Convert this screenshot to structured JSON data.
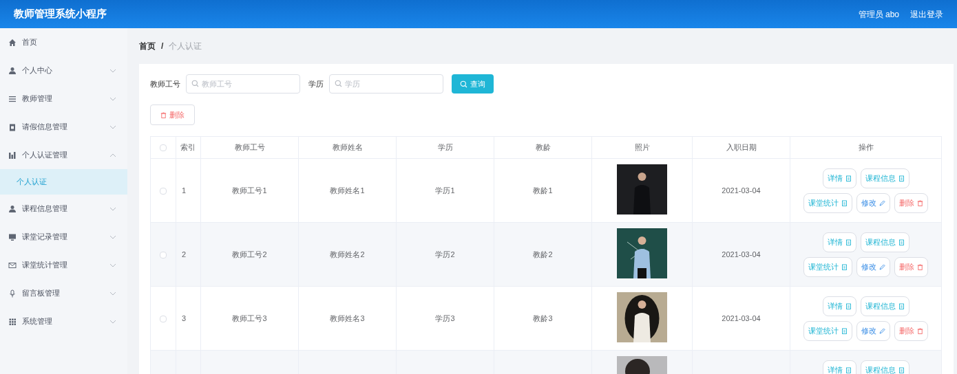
{
  "header": {
    "title": "教师管理系统小程序",
    "user": "管理员 abo",
    "logout": "退出登录"
  },
  "sidebar": {
    "items": [
      {
        "label": "首页"
      },
      {
        "label": "个人中心",
        "expanded": false
      },
      {
        "label": "教师管理",
        "expanded": false
      },
      {
        "label": "请假信息管理",
        "expanded": false
      },
      {
        "label": "个人认证管理",
        "expanded": true,
        "children": [
          {
            "label": "个人认证",
            "selected": true
          }
        ]
      },
      {
        "label": "课程信息管理",
        "expanded": false
      },
      {
        "label": "课堂记录管理",
        "expanded": false
      },
      {
        "label": "课堂统计管理",
        "expanded": false
      },
      {
        "label": "留言板管理",
        "expanded": false
      },
      {
        "label": "系统管理",
        "expanded": false
      }
    ]
  },
  "breadcrumb": {
    "separator": "/",
    "items": [
      "首页",
      "个人认证"
    ]
  },
  "search": {
    "fields": [
      {
        "label": "教师工号",
        "placeholder": "教师工号"
      },
      {
        "label": "学历",
        "placeholder": "学历"
      }
    ],
    "button": "查询"
  },
  "delete_button": "删除",
  "table": {
    "select_all_checked": false,
    "columns": [
      "索引",
      "教师工号",
      "教师姓名",
      "学历",
      "教龄",
      "照片",
      "入职日期",
      "操作"
    ],
    "rows": [
      {
        "checked": false,
        "cells": [
          "1",
          "教师工号1",
          "教师姓名1",
          "学历1",
          "教龄1"
        ],
        "date": "2021-03-04",
        "actions": [
          {
            "label": "详情",
            "kind": "info"
          },
          {
            "label": "课程信息",
            "kind": "info"
          },
          {
            "label": "课堂统计",
            "kind": "info"
          },
          {
            "label": "修改",
            "kind": "edit"
          },
          {
            "label": "删除",
            "kind": "delete"
          }
        ]
      },
      {
        "checked": false,
        "cells": [
          "2",
          "教师工号2",
          "教师姓名2",
          "学历2",
          "教龄2"
        ],
        "date": "2021-03-04",
        "actions": [
          {
            "label": "详情",
            "kind": "info"
          },
          {
            "label": "课程信息",
            "kind": "info"
          },
          {
            "label": "课堂统计",
            "kind": "info"
          },
          {
            "label": "修改",
            "kind": "edit"
          },
          {
            "label": "删除",
            "kind": "delete"
          }
        ]
      },
      {
        "checked": false,
        "cells": [
          "3",
          "教师工号3",
          "教师姓名3",
          "学历3",
          "教龄3"
        ],
        "date": "2021-03-04",
        "actions": [
          {
            "label": "详情",
            "kind": "info"
          },
          {
            "label": "课程信息",
            "kind": "info"
          },
          {
            "label": "课堂统计",
            "kind": "info"
          },
          {
            "label": "修改",
            "kind": "edit"
          },
          {
            "label": "删除",
            "kind": "delete"
          }
        ]
      },
      {
        "actions": [
          {
            "label": "详情",
            "kind": "info"
          },
          {
            "label": "课程信息",
            "kind": "info"
          }
        ]
      }
    ]
  }
}
